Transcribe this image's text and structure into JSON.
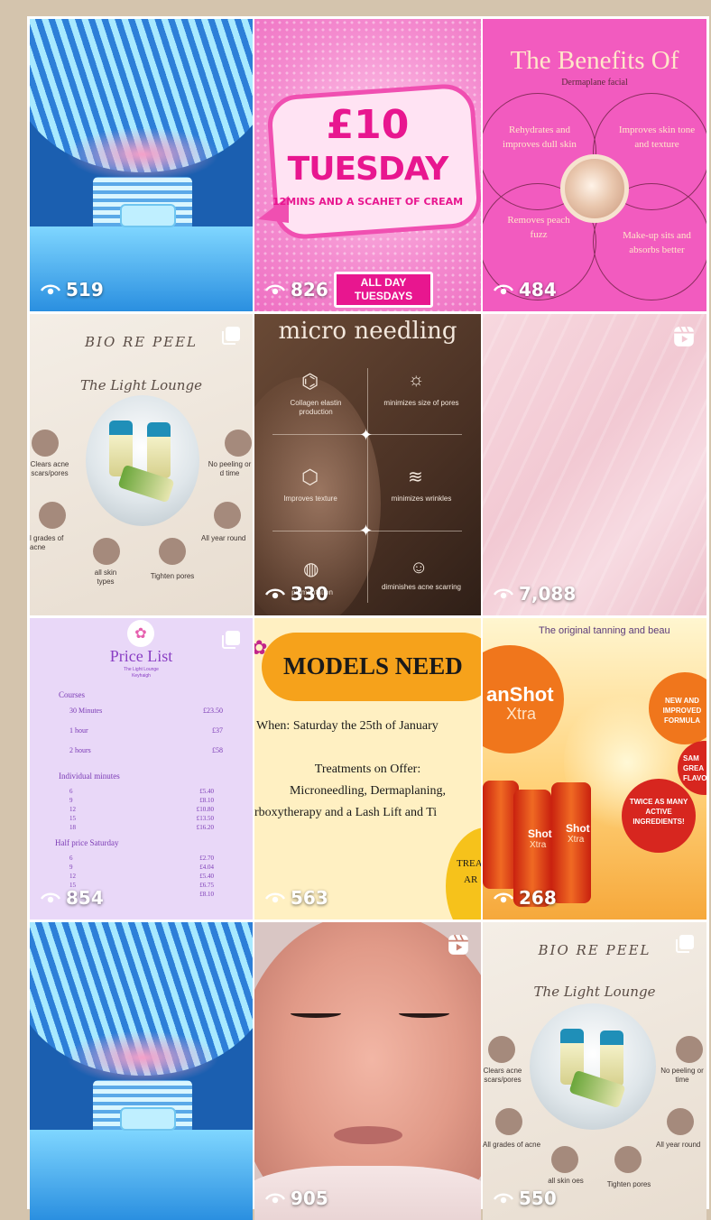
{
  "icons": {
    "views": "eye-icon",
    "multi": "carousel-icon",
    "reel": "reels-icon"
  },
  "colors": {
    "background": "#d4c4ad",
    "pink": "#f25bbf",
    "tan_orange": "#e5721c",
    "lilac": "#e9d8f8"
  },
  "tiles": [
    {
      "views": "519"
    },
    {
      "views": "826",
      "price": "£10",
      "day": "TUESDAY",
      "sub": "12MINS AND A SCAHET OF CREAM",
      "badge_line1": "ALL DAY",
      "badge_line2": "TUESDAYS"
    },
    {
      "views": "484",
      "title": "The Benefits Of",
      "subtitle": "Dermaplane facial",
      "b1": "Rehydrates and improves dull skin",
      "b2": "Improves skin tone and texture",
      "b3": "Removes peach fuzz",
      "b4": "Make-up sits and absorbs better"
    },
    {
      "title": "BIO RE PEEL",
      "script": "The Light Lounge",
      "f1": "Clears acne scars/pores",
      "f2": "No peeling or d time",
      "f3": "l grades of acne",
      "f4": "All year round",
      "f5": "all skin types",
      "f6": "Tighten pores"
    },
    {
      "views": "330",
      "title": "micro needling",
      "m1": "Collagen elastin production",
      "m2": "minimizes size of pores",
      "m3": "Improves texture",
      "m4": "minimizes wrinkles",
      "m5": "pigmentation",
      "m6": "diminishes acne scarring"
    },
    {
      "views": "7,088"
    },
    {
      "views": "854",
      "title": "Price List",
      "brand": "The Light Lounge",
      "town": "Keyhaigh",
      "courses_label": "Courses",
      "courses": [
        {
          "k": "30 Minutes",
          "v": "£23.50"
        },
        {
          "k": "1 hour",
          "v": "£37"
        },
        {
          "k": "2 hours",
          "v": "£58"
        }
      ],
      "individual_label": "Individual minutes",
      "individual": [
        {
          "k": "6",
          "v": "£5.40"
        },
        {
          "k": "9",
          "v": "£8.10"
        },
        {
          "k": "12",
          "v": "£10.80"
        },
        {
          "k": "15",
          "v": "£13.50"
        },
        {
          "k": "18",
          "v": "£16.20"
        }
      ],
      "half_label": "Half price Saturday",
      "half": [
        {
          "k": "6",
          "v": "£2.70"
        },
        {
          "k": "9",
          "v": "£4.04"
        },
        {
          "k": "12",
          "v": "£5.40"
        },
        {
          "k": "15",
          "v": "£6.75"
        },
        {
          "k": "18",
          "v": "£8.10"
        }
      ]
    },
    {
      "views": "563",
      "banner": "MODELS NEED",
      "when": "When: Saturday the 25th of January",
      "offer_line1": "Treatments on Offer:",
      "offer_line2": "Microneedling, Dermaplaning,",
      "offer_line3": "rboxytherapy and a Lash Lift and Ti",
      "corner1": "TREA",
      "corner2": "AR"
    },
    {
      "views": "268",
      "headline": "The original tanning and beau",
      "logo1": "anShot",
      "logo2": "Xtra",
      "bubble1": "NEW AND IMPROVED FORMULA",
      "bubble2": "SAM GREA FLAVO",
      "bubble3": "TWICE AS MANY ACTIVE INGREDIENTS!",
      "bottle_text": "Shot",
      "bottle_sub": "Xtra"
    },
    {},
    {
      "views": "905"
    },
    {
      "views": "550",
      "title": "BIO RE PEEL",
      "script": "The Light Lounge",
      "f1": "Clears acne scars/pores",
      "f2": "No peeling or time",
      "f3": "All grades of acne",
      "f4": "All year round",
      "f5": "all skin oes",
      "f6": "Tighten pores"
    }
  ]
}
